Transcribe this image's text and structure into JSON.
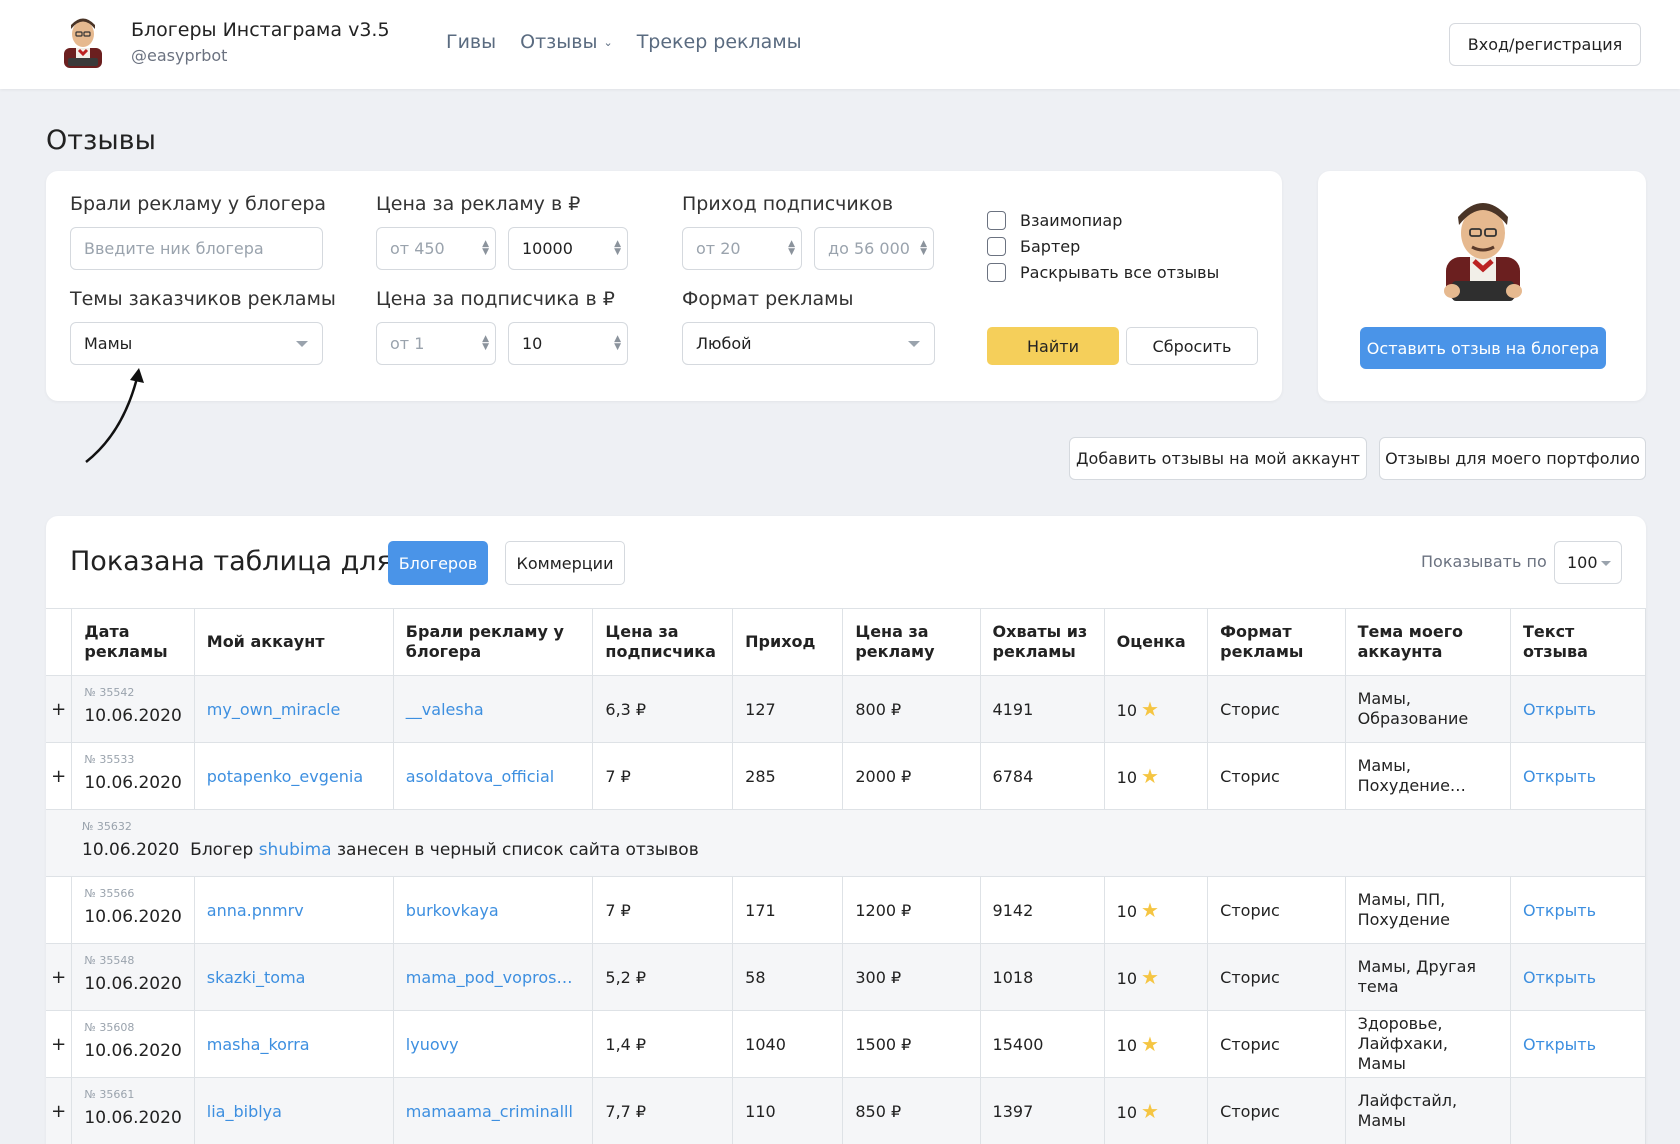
{
  "header": {
    "title": "Блогеры Инстаграма v3.5",
    "subtitle": "@easyprbot",
    "nav": [
      "Гивы",
      "Отзывы",
      "Трекер рекламы"
    ],
    "login": "Вход/регистрация"
  },
  "page_title": "Отзывы",
  "filters": {
    "blogger_label": "Брали рекламу у блогера",
    "blogger_placeholder": "Введите ник блогера",
    "themes_label": "Темы заказчиков рекламы",
    "themes_value": "Мамы",
    "price_ad_label": "Цена за рекламу в ₽",
    "price_ad_from_placeholder": "от 450",
    "price_ad_to_value": "10000",
    "price_sub_label": "Цена за подписчика в ₽",
    "price_sub_from_placeholder": "от 1",
    "price_sub_to_value": "10",
    "subs_label": "Приход подписчиков",
    "subs_from_placeholder": "от 20",
    "subs_to_placeholder": "до 56 000",
    "format_label": "Формат рекламы",
    "format_value": "Любой",
    "checks": [
      "Взаимопиар",
      "Бартер",
      "Раскрывать все отзывы"
    ],
    "find": "Найти",
    "reset": "Сбросить"
  },
  "side": {
    "review_button": "Оставить отзыв на блогера"
  },
  "actions": {
    "add_reviews": "Добавить отзывы на мой аккаунт",
    "portfolio": "Отзывы для моего портфолио"
  },
  "table": {
    "title": "Показана таблица для",
    "tab_bloggers": "Блогеров",
    "tab_commerce": "Коммерции",
    "show_label": "Показывать по",
    "show_value": "100",
    "headers": [
      "Дата рекламы",
      "Мой аккаунт",
      "Брали рекламу у блогера",
      "Цена за подписчика",
      "Приход",
      "Цена за рекламу",
      "Охваты из рекламы",
      "Оценка",
      "Формат рекламы",
      "Тема моего аккаунта",
      "Текст отзыва"
    ],
    "rows": [
      {
        "plus": "+",
        "num": "№ 35542",
        "date": "10.06.2020",
        "account": "my_own_miracle",
        "blogger": "__valesha",
        "price_sub": "6,3 ₽",
        "income": "127",
        "price_ad": "800 ₽",
        "reach": "4191",
        "rating": "10",
        "format": "Сторис",
        "topic": "Мамы, Образование",
        "link": "Открыть"
      },
      {
        "plus": "+",
        "num": "№ 35533",
        "date": "10.06.2020",
        "account": "potapenko_evgenia",
        "blogger": "asoldatova_official",
        "price_sub": "7 ₽",
        "income": "285",
        "price_ad": "2000 ₽",
        "reach": "6784",
        "rating": "10",
        "format": "Сторис",
        "topic": "Мамы, Похудение…",
        "link": "Открыть"
      }
    ],
    "notice": {
      "num": "№ 35632",
      "date": "10.06.2020",
      "prefix": "Блогер",
      "blogger": "shubima",
      "suffix": "занесен в черный список сайта отзывов"
    },
    "rows2": [
      {
        "plus": "",
        "num": "№ 35566",
        "date": "10.06.2020",
        "account": "anna.pnmrv",
        "blogger": "burkovkaya",
        "price_sub": "7 ₽",
        "income": "171",
        "price_ad": "1200 ₽",
        "reach": "9142",
        "rating": "10",
        "format": "Сторис",
        "topic": "Мамы, ПП, Похудение",
        "link": "Открыть"
      },
      {
        "plus": "+",
        "num": "№ 35548",
        "date": "10.06.2020",
        "account": "skazki_toma",
        "blogger": "mama_pod_vopros…",
        "price_sub": "5,2 ₽",
        "income": "58",
        "price_ad": "300 ₽",
        "reach": "1018",
        "rating": "10",
        "format": "Сторис",
        "topic": "Мамы, Другая тема",
        "link": "Открыть"
      },
      {
        "plus": "+",
        "num": "№ 35608",
        "date": "10.06.2020",
        "account": "masha_korra",
        "blogger": "lyuovy",
        "price_sub": "1,4 ₽",
        "income": "1040",
        "price_ad": "1500 ₽",
        "reach": "15400",
        "rating": "10",
        "format": "Сторис",
        "topic": "Здоровье, Лайфхаки, Мамы",
        "link": "Открыть"
      },
      {
        "plus": "+",
        "num": "№ 35661",
        "date": "10.06.2020",
        "account": "lia_biblya",
        "blogger": "mamaama_criminalll",
        "price_sub": "7,7 ₽",
        "income": "110",
        "price_ad": "850 ₽",
        "reach": "1397",
        "rating": "10",
        "format": "Сторис",
        "topic": "Лайфстайл, Мамы",
        "link": ""
      }
    ]
  },
  "colors": {
    "accent": "#4a94e8",
    "link": "#3d8fe0",
    "find": "#f5cf5a",
    "star": "#f5c542"
  }
}
